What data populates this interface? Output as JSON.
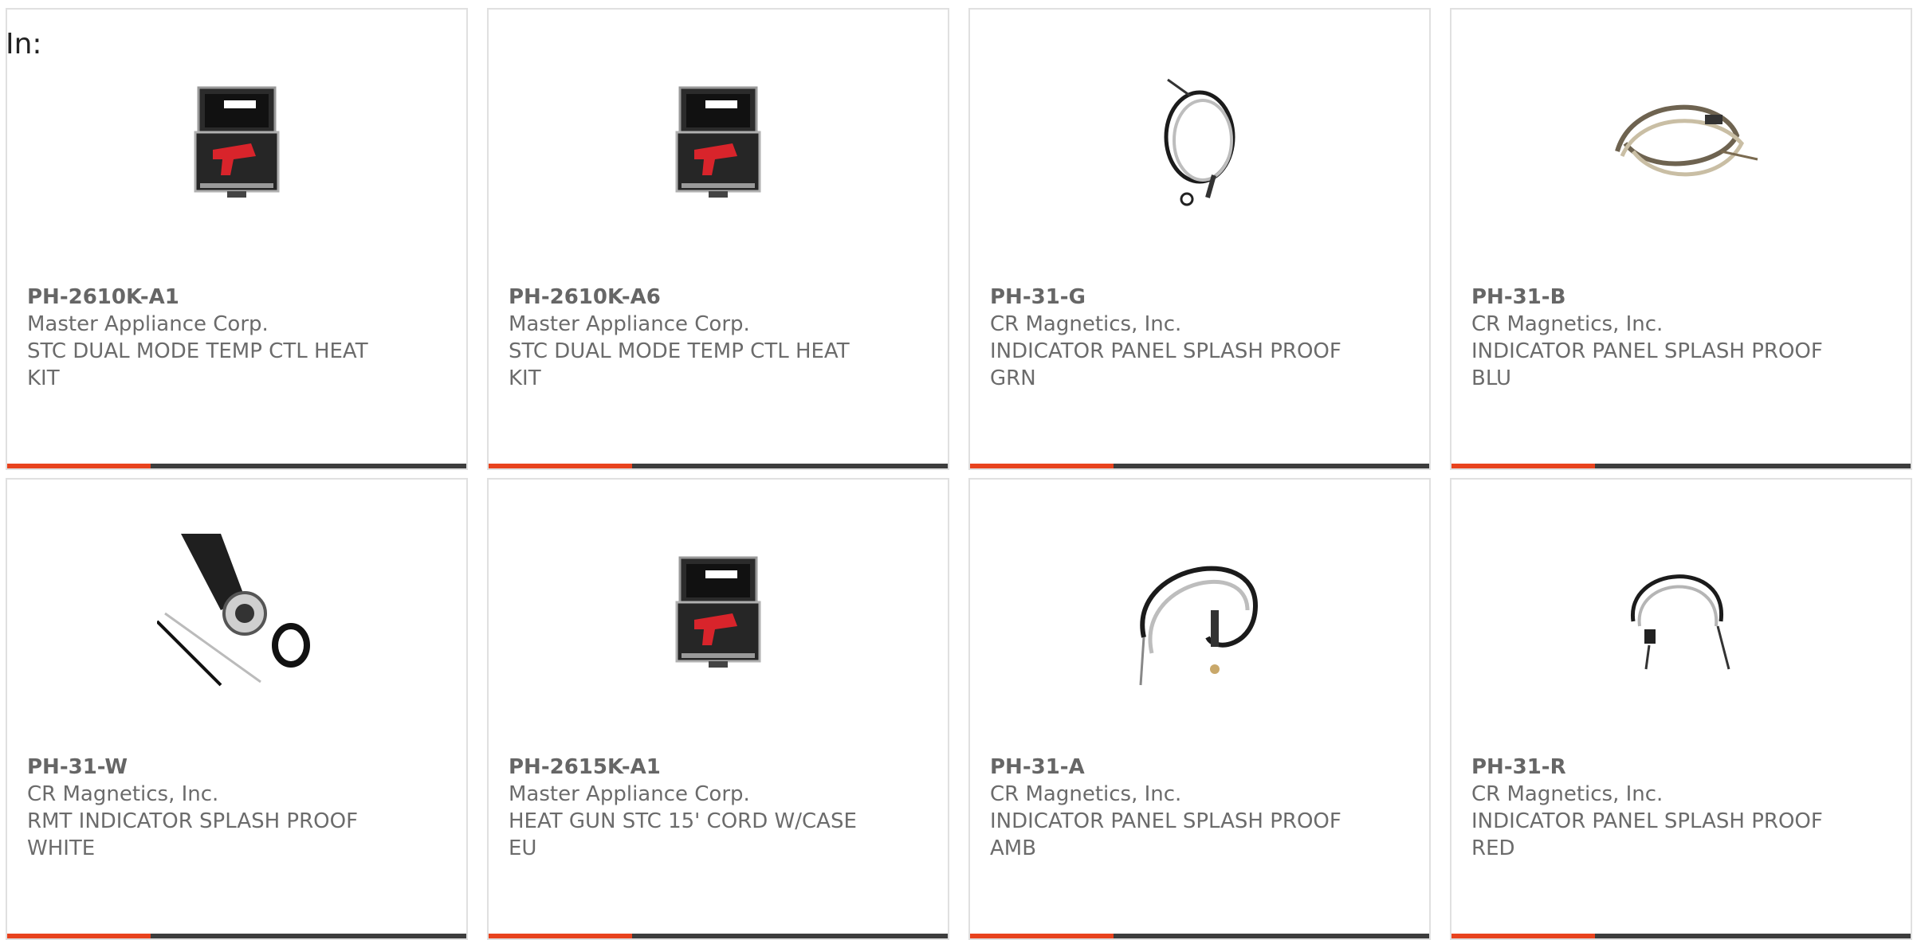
{
  "filter": {
    "label": "In:"
  },
  "products": [
    {
      "part": "PH-2610K-A1",
      "manufacturer": "Master Appliance Corp.",
      "description": "STC DUAL MODE TEMP CTL HEAT KIT",
      "image": "heat-gun-kit"
    },
    {
      "part": "PH-2610K-A6",
      "manufacturer": "Master Appliance Corp.",
      "description": "STC DUAL MODE TEMP CTL HEAT KIT",
      "image": "heat-gun-kit"
    },
    {
      "part": "PH-31-G",
      "manufacturer": "CR Magnetics, Inc.",
      "description": "INDICATOR PANEL SPLASH PROOF GRN",
      "image": "indicator-wire"
    },
    {
      "part": "PH-31-B",
      "manufacturer": "CR Magnetics, Inc.",
      "description": "INDICATOR PANEL SPLASH PROOF BLU",
      "image": "indicator-wire-tan"
    },
    {
      "part": "PH-31-W",
      "manufacturer": "CR Magnetics, Inc.",
      "description": "RMT INDICATOR SPLASH PROOF WHITE",
      "image": "indicator-closeup"
    },
    {
      "part": "PH-2615K-A1",
      "manufacturer": "Master Appliance Corp.",
      "description": "HEAT GUN STC 15' CORD W/CASE EU",
      "image": "heat-gun-kit"
    },
    {
      "part": "PH-31-A",
      "manufacturer": "CR Magnetics, Inc.",
      "description": "INDICATOR PANEL SPLASH PROOF AMB",
      "image": "indicator-wire"
    },
    {
      "part": "PH-31-R",
      "manufacturer": "CR Magnetics, Inc.",
      "description": "INDICATOR PANEL SPLASH PROOF RED",
      "image": "indicator-wire"
    }
  ],
  "colors": {
    "accent": "#e8431e",
    "bar": "#3d3d3d",
    "text": "#6b6b6b",
    "border": "#e0e0e0"
  }
}
